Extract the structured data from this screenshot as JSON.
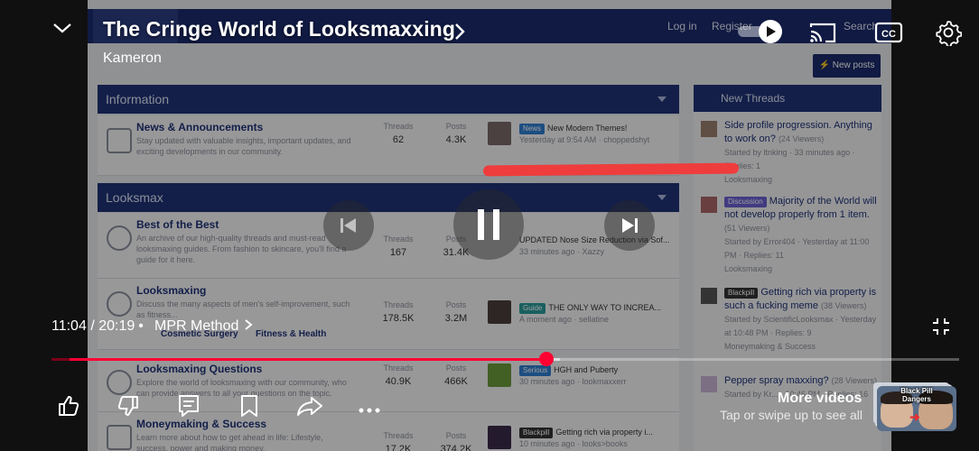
{
  "player": {
    "title": "The Cringe World of Looksmaxxing",
    "channel": "Kameron",
    "current_time": "11:04",
    "separator": "/",
    "duration": "20:19",
    "dot": "•",
    "chapter": "MPR Method",
    "progress_fraction": 0.545,
    "buffered_fraction": 0.56,
    "more_videos_label": "More videos",
    "swipe_hint": "Tap or swipe up to see all",
    "thumbnail_caption_line1": "Black Pill",
    "thumbnail_caption_line2": "Dangers",
    "accent_color": "#ff0033",
    "icons": [
      "chevron-down-icon",
      "autoplay-toggle-icon",
      "cast-icon",
      "captions-icon",
      "settings-icon",
      "previous-icon",
      "pause-icon",
      "next-icon",
      "fullscreen-exit-icon",
      "like-icon",
      "dislike-icon",
      "comments-icon",
      "save-icon",
      "share-icon",
      "more-icon"
    ]
  },
  "forum": {
    "nav_login": "Log in",
    "nav_register": "Register",
    "nav_search": "Search",
    "new_posts": "New posts",
    "categories": [
      {
        "label": "Information"
      },
      {
        "label": "Looksmax"
      }
    ],
    "nodes": [
      {
        "title": "News & Announcements",
        "desc": "Stay updated with valuable insights, important updates, and exciting developments in our community.",
        "threads_label": "Threads",
        "threads": "62",
        "posts_label": "Posts",
        "posts": "4.3K",
        "badge": "News",
        "latest": "New Modern Themes!",
        "meta": "Yesterday at 9:54 AM · choppedshyt"
      },
      {
        "title": "Best of the Best",
        "desc": "An archive of our high-quality threads and must-read looksmaxing guides. From fashion to skincare, you'll find a guide for it here.",
        "threads_label": "Threads",
        "threads": "167",
        "posts_label": "Posts",
        "posts": "31.4K",
        "badge": "",
        "latest": "UPDATED Nose Size Reduction via Sof...",
        "meta": "33 minutes ago · Xazzy"
      },
      {
        "title": "Looksmaxing",
        "desc": "Discuss the many aspects of men's self-improvement, such as fitness...",
        "threads_label": "Threads",
        "threads": "178.5K",
        "posts_label": "Posts",
        "posts": "3.2M",
        "badge": "Guide",
        "latest": "THE ONLY WAY TO INCREA...",
        "meta": "A moment ago · sellatine",
        "sub1": "Cosmetic Surgery",
        "sub2": "Fitness & Health"
      },
      {
        "title": "Looksmaxing Questions",
        "desc": "Explore the world of looksmaxing with our community, who can provide answers to all your questions on the topic.",
        "threads_label": "Threads",
        "threads": "40.9K",
        "posts_label": "Posts",
        "posts": "466K",
        "badge": "Serious",
        "latest": "HGH and Puberty",
        "meta": "30 minutes ago · lookmaxxerr"
      },
      {
        "title": "Moneymaking & Success",
        "desc": "Learn more about how to get ahead in life: Lifestyle, success, power and making money.",
        "threads_label": "Threads",
        "threads": "17.2K",
        "posts_label": "Posts",
        "posts": "374.2K",
        "badge": "Blackpill",
        "latest": "Getting rich via property i...",
        "meta": "10 minutes ago · looks>books"
      }
    ],
    "sidebar_title": "New Threads",
    "new_threads": [
      {
        "title": "Side profile progression. Anything to work on?",
        "viewers": "(24 Viewers)",
        "meta1": "Started by ltnking · 33 minutes ago ·",
        "meta2": "Replies: 1",
        "meta3": "Looksmaxing"
      },
      {
        "badge": "Discussion",
        "title": "Majority of the World will not develop properly from 1 item.",
        "viewers": "(51 Viewers)",
        "meta1": "Started by Error404 · Yesterday at 11:00 PM · Replies: 11",
        "meta3": "Looksmaxing"
      },
      {
        "badge": "Blackpill",
        "title": "Getting rich via property is such a fucking meme",
        "viewers": "(38 Viewers)",
        "meta1": "Started by ScientificLooksmax · Yesterday at 10:48 PM · Replies: 9",
        "meta3": "Moneymaking & Success"
      },
      {
        "title": "Pepper spray maxxing?",
        "viewers": "(28 Viewers)",
        "meta1": "Started by Kr... · 10:46 PM · Replies: 16",
        "meta3": ""
      }
    ]
  }
}
